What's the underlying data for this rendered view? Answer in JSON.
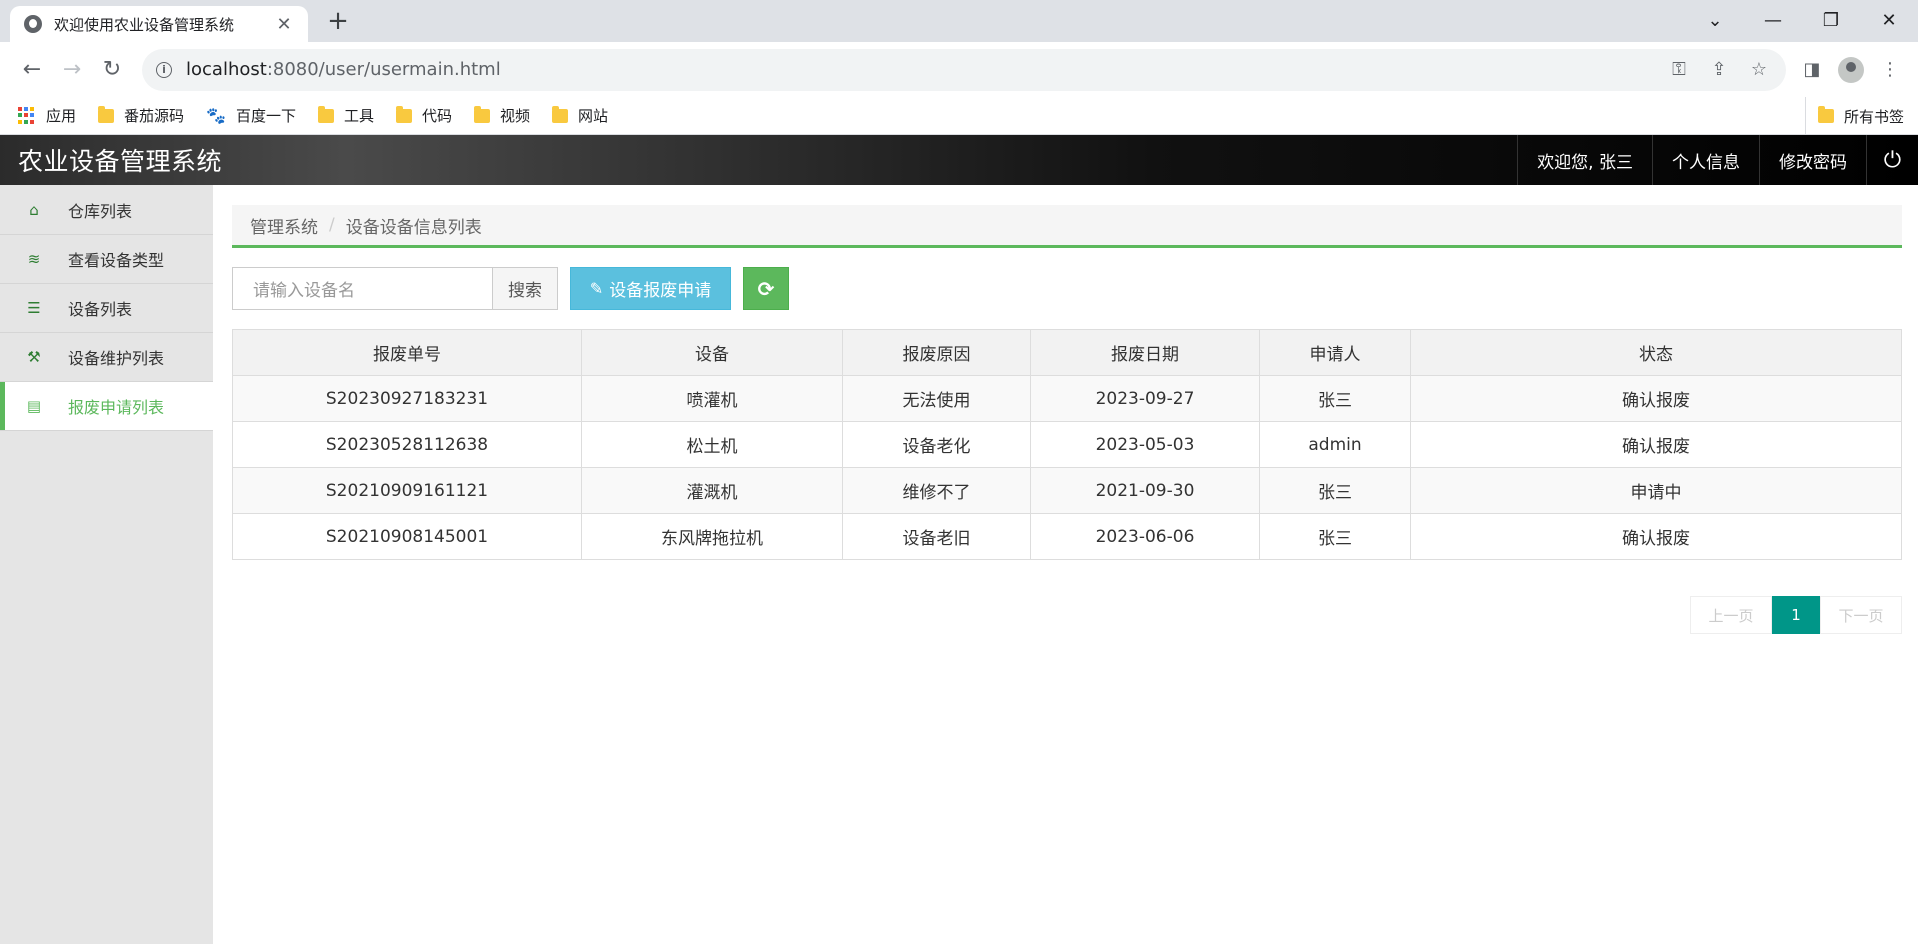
{
  "browser": {
    "tab_title": "欢迎使用农业设备管理系统",
    "tab_close": "✕",
    "new_tab": "+",
    "url_host": "localhost",
    "url_path": ":8080/user/usermain.html",
    "bookmarks": [
      {
        "label": "应用",
        "icon": "apps-icon"
      },
      {
        "label": "番茄源码",
        "icon": "folder-icon"
      },
      {
        "label": "百度一下",
        "icon": "baidu-paw-icon"
      },
      {
        "label": "工具",
        "icon": "folder-icon"
      },
      {
        "label": "代码",
        "icon": "folder-icon"
      },
      {
        "label": "视频",
        "icon": "folder-icon"
      },
      {
        "label": "网站",
        "icon": "folder-icon"
      }
    ],
    "all_bookmarks": "所有书签"
  },
  "header": {
    "title": "农业设备管理系统",
    "welcome": "欢迎您, 张三",
    "profile": "个人信息",
    "change_password": "修改密码",
    "logout_icon": "power-icon"
  },
  "sidebar": {
    "items": [
      {
        "label": "仓库列表",
        "icon": "home-icon",
        "glyph": "⌂"
      },
      {
        "label": "查看设备类型",
        "icon": "database-icon",
        "glyph": "≋"
      },
      {
        "label": "设备列表",
        "icon": "list-icon",
        "glyph": "☰"
      },
      {
        "label": "设备维护列表",
        "icon": "wrench-icon",
        "glyph": "⚒"
      },
      {
        "label": "报废申请列表",
        "icon": "archive-icon",
        "glyph": "▤",
        "active": true
      }
    ]
  },
  "breadcrumb": {
    "root": "管理系统",
    "separator": "/",
    "current": "设备设备信息列表"
  },
  "search": {
    "placeholder": "请输入设备名",
    "button": "搜索"
  },
  "actions": {
    "scrap_apply": "设备报废申请",
    "refresh_icon": "refresh-icon"
  },
  "table": {
    "columns": [
      "报废单号",
      "设备",
      "报废原因",
      "报废日期",
      "申请人",
      "状态"
    ],
    "rows": [
      [
        "S20230927183231",
        "喷灌机",
        "无法使用",
        "2023-09-27",
        "张三",
        "确认报废"
      ],
      [
        "S20230528112638",
        "松土机",
        "设备老化",
        "2023-05-03",
        "admin",
        "确认报废"
      ],
      [
        "S20210909161121",
        "灌溉机",
        "维修不了",
        "2021-09-30",
        "张三",
        "申请中"
      ],
      [
        "S20210908145001",
        "东风牌拖拉机",
        "设备老旧",
        "2023-06-06",
        "张三",
        "确认报废"
      ]
    ]
  },
  "pager": {
    "prev": "上一页",
    "current": "1",
    "next": "下一页"
  },
  "colors": {
    "accent_green": "#5cb85c",
    "info_blue": "#5bc0de",
    "pager_teal": "#009688"
  }
}
